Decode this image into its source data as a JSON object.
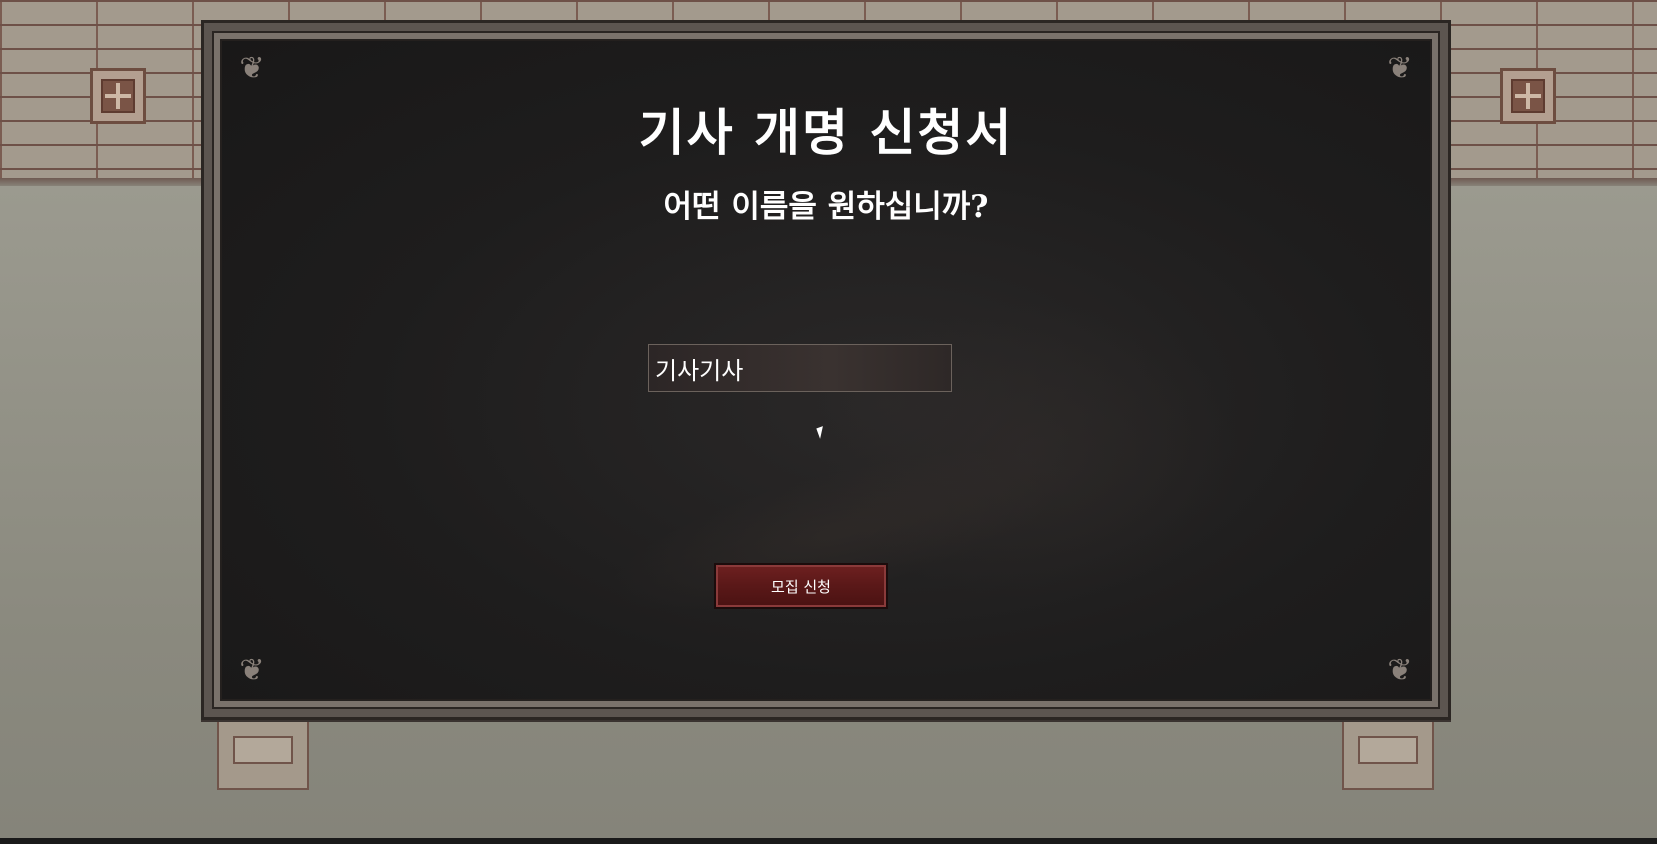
{
  "dialog": {
    "title": "기사 개명 신청서",
    "subtitle": "어떤 이름을 원하십니까?",
    "name_input": {
      "value": "기사기사",
      "placeholder": ""
    },
    "submit_label": "모집 신청"
  },
  "icons": {
    "corner_ornament": "corner-ornament-icon",
    "cursor": "mouse-cursor-icon",
    "window": "castle-window-icon"
  },
  "colors": {
    "panel_background": "#1e1d1d",
    "button": "#5a1818",
    "text": "#ffffff"
  }
}
